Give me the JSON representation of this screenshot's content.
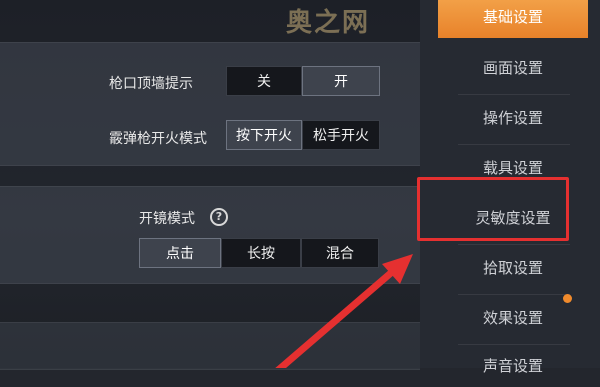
{
  "watermark": "奥之网",
  "settings": {
    "muzzle_wall_hint": {
      "label": "枪口顶墙提示",
      "options": [
        "关",
        "开"
      ],
      "selected": "开"
    },
    "shotgun_fire_mode": {
      "label": "霰弹枪开火模式",
      "options": [
        "按下开火",
        "松手开火"
      ],
      "selected": "按下开火"
    },
    "scope_mode": {
      "label": "开镜模式",
      "options": [
        "点击",
        "长按",
        "混合"
      ],
      "selected": "点击"
    }
  },
  "sidebar": {
    "items": [
      {
        "label": "基础设置",
        "active": true
      },
      {
        "label": "画面设置",
        "active": false
      },
      {
        "label": "操作设置",
        "active": false
      },
      {
        "label": "载具设置",
        "active": false
      },
      {
        "label": "灵敏度设置",
        "active": false,
        "highlighted": true
      },
      {
        "label": "拾取设置",
        "active": false
      },
      {
        "label": "效果设置",
        "active": false,
        "notification": true
      },
      {
        "label": "声音设置",
        "active": false
      }
    ]
  },
  "colors": {
    "accent": "#ee8f33",
    "annotation": "#e53030"
  },
  "icons": {
    "help": "question-circle-icon"
  }
}
